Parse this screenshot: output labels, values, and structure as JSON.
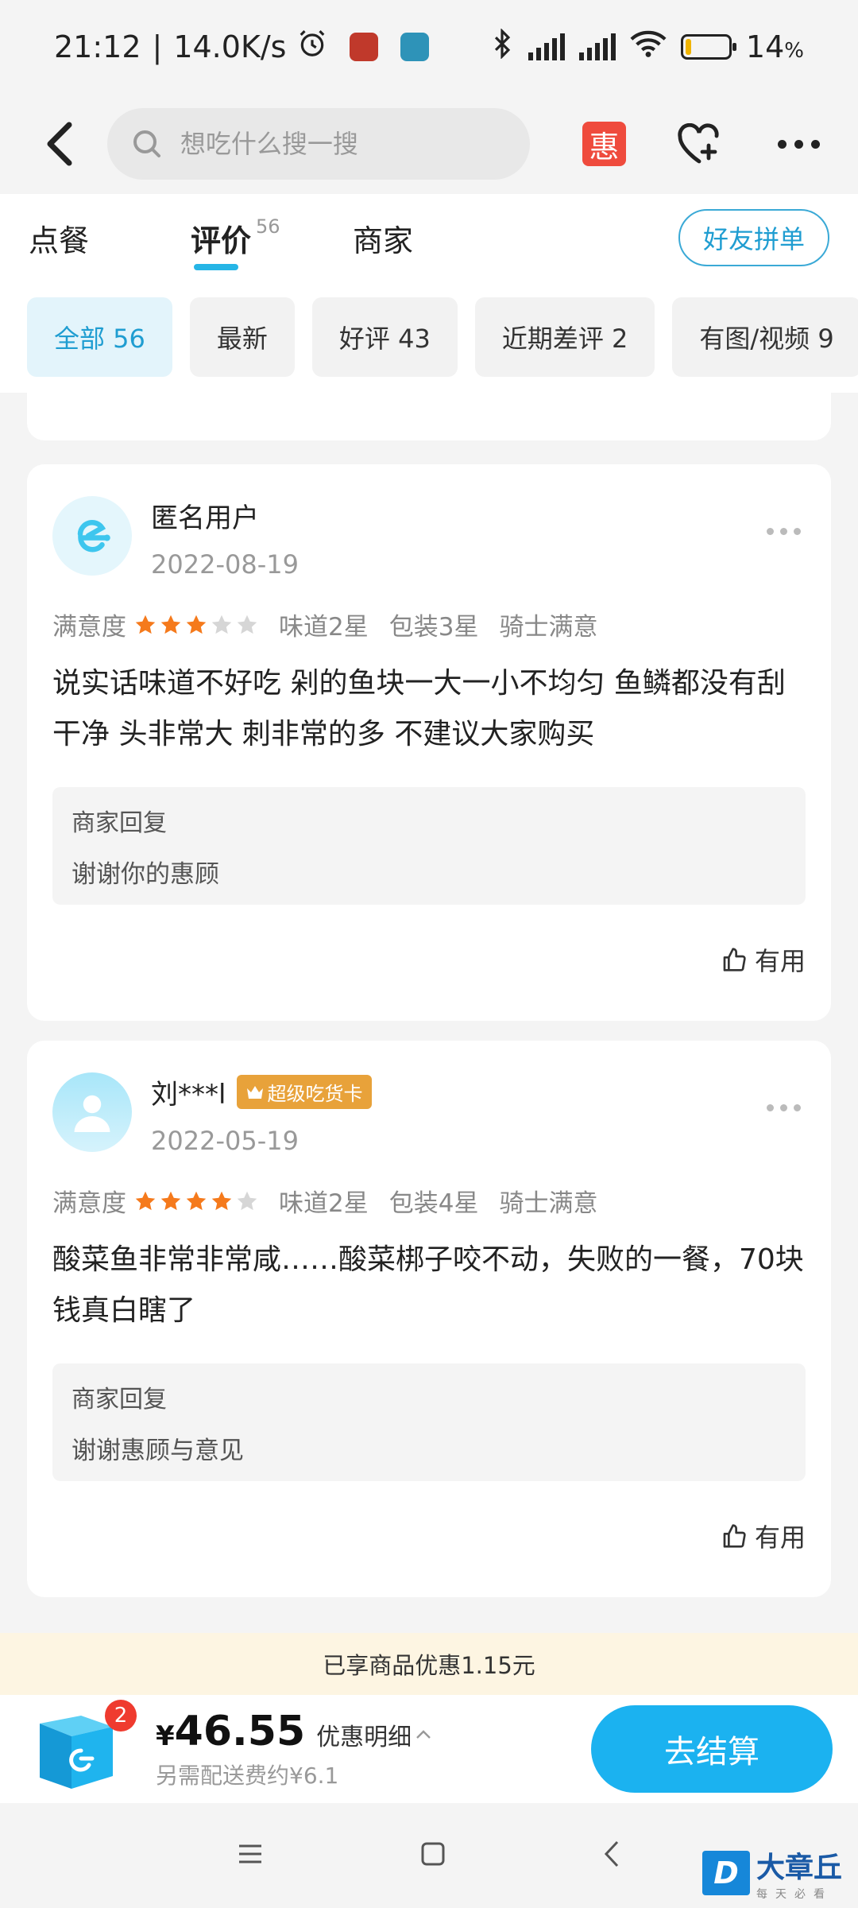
{
  "status_bar": {
    "time": "21:12",
    "speed": "14.0K/s",
    "battery": "14",
    "battery_unit": "%",
    "battery_level": 0.14
  },
  "nav": {
    "search_placeholder": "想吃什么搜一搜",
    "hui_label": "惠"
  },
  "tabs": [
    {
      "label": "点餐"
    },
    {
      "label": "评价",
      "count": "56"
    },
    {
      "label": "商家"
    }
  ],
  "friends_button": "好友拼单",
  "filters": [
    {
      "label": "全部 56"
    },
    {
      "label": "最新"
    },
    {
      "label": "好评 43"
    },
    {
      "label": "近期差评 2"
    },
    {
      "label": "有图/视频 9"
    }
  ],
  "reviews": [
    {
      "user": "匿名用户",
      "date": "2022-08-19",
      "satisfaction_label": "满意度",
      "stars": 3,
      "taste": "味道2星",
      "packaging": "包装3星",
      "rider": "骑士满意",
      "text": "说实话味道不好吃 剁的鱼块一大一小不均匀 鱼鳞都没有刮干净 头非常大 刺非常的多 不建议大家购买",
      "reply_title": "商家回复",
      "reply_text": "谢谢你的惠顾",
      "useful_label": "有用"
    },
    {
      "user": "刘***l",
      "badge": "超级吃货卡",
      "date": "2022-05-19",
      "satisfaction_label": "满意度",
      "stars": 4,
      "taste": "味道2星",
      "packaging": "包装4星",
      "rider": "骑士满意",
      "text": "酸菜鱼非常非常咸……酸菜梆子咬不动，失败的一餐，70块钱真白瞎了",
      "reply_title": "商家回复",
      "reply_text": "谢谢惠顾与意见",
      "useful_label": "有用"
    }
  ],
  "promo": "已享商品优惠1.15元",
  "cart": {
    "count": "2",
    "currency": "¥",
    "price": "46.55",
    "detail_label": "优惠明细",
    "delivery_fee": "另需配送费约¥6.1",
    "checkout_label": "去结算"
  },
  "watermark": {
    "logo": "D",
    "title": "大章丘",
    "subtitle": "每天必看"
  },
  "colors": {
    "accent": "#1bb2f0",
    "star_on": "#f57a1c",
    "star_off": "#d6d6d6",
    "badge": "#e8a23a",
    "promo_bg": "#fdf5e2"
  }
}
